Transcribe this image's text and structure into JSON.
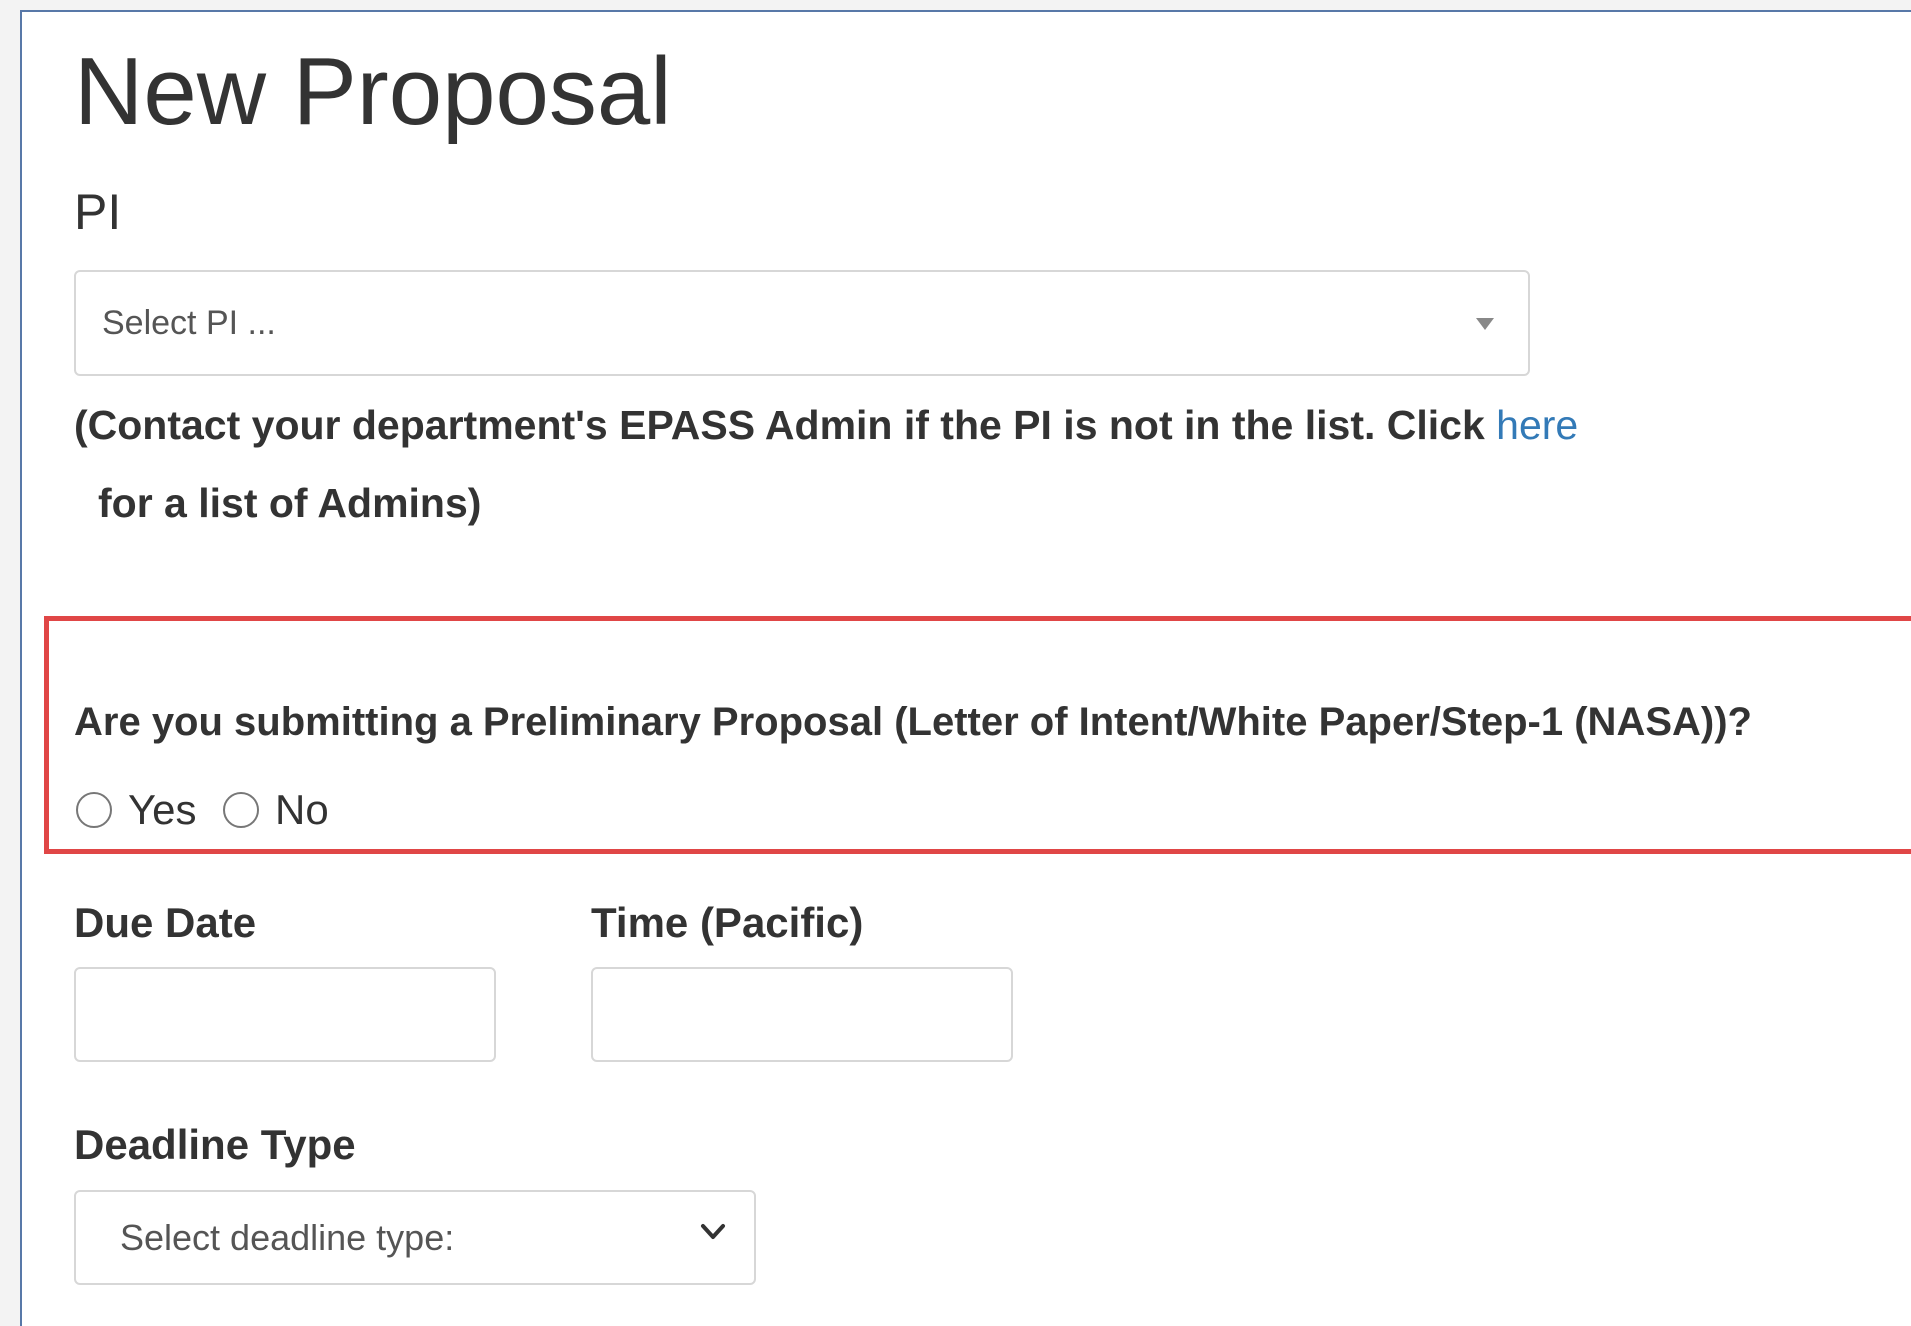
{
  "page": {
    "title": "New Proposal"
  },
  "pi": {
    "label": "PI",
    "placeholder": "Select PI ...",
    "help_text_before": "(Contact your department's EPASS Admin if the PI is not in the list. Click ",
    "help_link": "here",
    "help_text_after": "for a list of Admins)"
  },
  "preliminary": {
    "question": "Are you submitting a Preliminary Proposal (Letter of Intent/White Paper/Step-1 (NASA))?",
    "options": [
      {
        "label": "Yes",
        "selected": false
      },
      {
        "label": "No",
        "selected": false
      }
    ]
  },
  "due_date": {
    "label": "Due Date",
    "value": ""
  },
  "time": {
    "label": "Time (Pacific)",
    "value": ""
  },
  "deadline_type": {
    "label": "Deadline Type",
    "selected": "Select deadline type:"
  },
  "icons": {
    "pi_select_arrow": "triangle-down-icon",
    "deadline_select_arrow": "chevron-down-icon"
  },
  "colors": {
    "link": "#337ab7",
    "highlight_border": "#e04646",
    "frame_border": "#5878a8"
  }
}
